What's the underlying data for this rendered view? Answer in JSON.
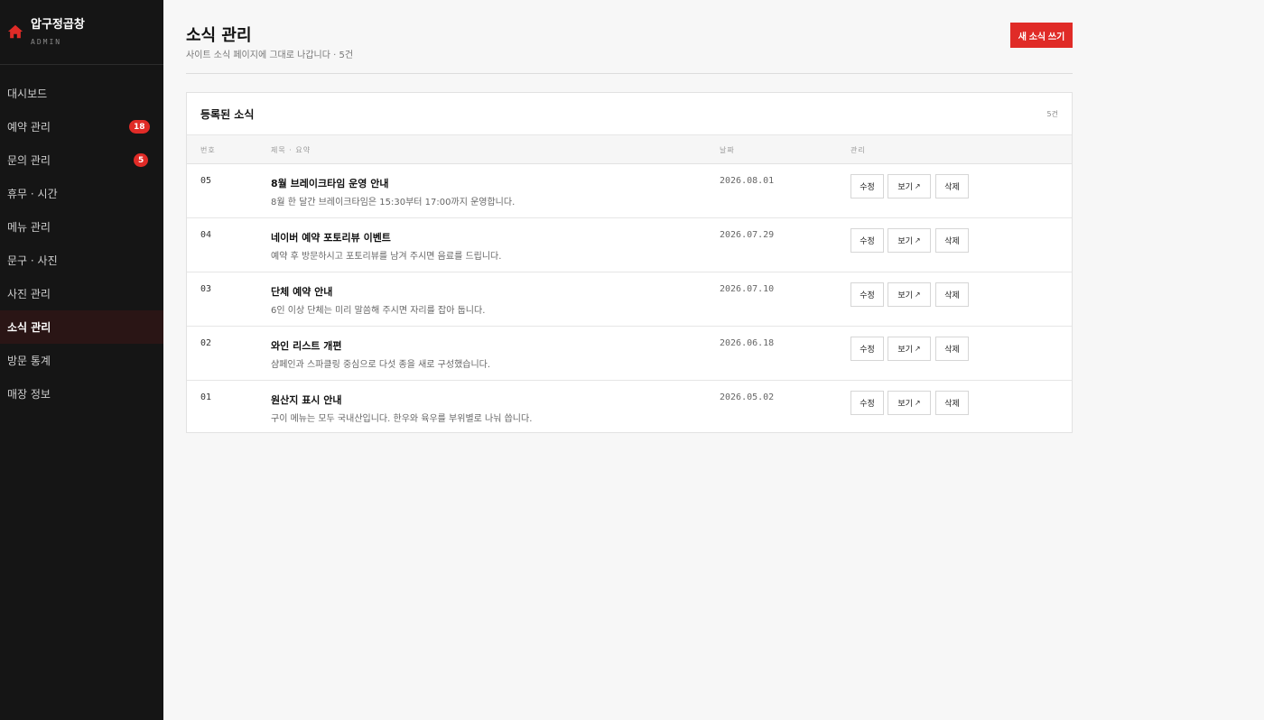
{
  "brand": {
    "name": "압구정곱창",
    "sub": "ADMIN",
    "icon": "home-icon",
    "accent": "#e02b27"
  },
  "sidebar": {
    "items": [
      {
        "label": "대시보드"
      },
      {
        "label": "예약 관리",
        "badge": "18"
      },
      {
        "label": "문의 관리",
        "badge": "5"
      },
      {
        "label": "휴무 · 시간"
      },
      {
        "label": "메뉴 관리"
      },
      {
        "label": "문구 · 사진"
      },
      {
        "label": "사진 관리"
      },
      {
        "label": "소식 관리",
        "active": true
      },
      {
        "label": "방문 통계"
      },
      {
        "label": "매장 정보"
      }
    ]
  },
  "header": {
    "title": "소식 관리",
    "subtitle": "사이트 소식 페이지에 그대로 나갑니다 · 5건",
    "new_button": "새 소식 쓰기"
  },
  "table": {
    "card_title": "등록된 소식",
    "count": "5건",
    "columns": {
      "num": "번호",
      "title": "제목 · 요약",
      "date": "날짜",
      "manage": "관리"
    },
    "actions": {
      "edit": "수정",
      "view": "보기",
      "view_icon": "external-link-icon",
      "delete": "삭제"
    },
    "rows": [
      {
        "num": "05",
        "title": "8월 브레이크타임 운영 안내",
        "summary": "8월 한 달간 브레이크타임은 15:30부터 17:00까지 운영합니다.",
        "date": "2026.08.01"
      },
      {
        "num": "04",
        "title": "네이버 예약 포토리뷰 이벤트",
        "summary": "예약 후 방문하시고 포토리뷰를 남겨 주시면 음료를 드립니다.",
        "date": "2026.07.29"
      },
      {
        "num": "03",
        "title": "단체 예약 안내",
        "summary": "6인 이상 단체는 미리 말씀해 주시면 자리를 잡아 둡니다.",
        "date": "2026.07.10"
      },
      {
        "num": "02",
        "title": "와인 리스트 개편",
        "summary": "샴페인과 스파클링 중심으로 다섯 종을 새로 구성했습니다.",
        "date": "2026.06.18"
      },
      {
        "num": "01",
        "title": "원산지 표시 안내",
        "summary": "구이 메뉴는 모두 국내산입니다. 한우와 육우를 부위별로 나눠 씁니다.",
        "date": "2026.05.02"
      }
    ]
  }
}
